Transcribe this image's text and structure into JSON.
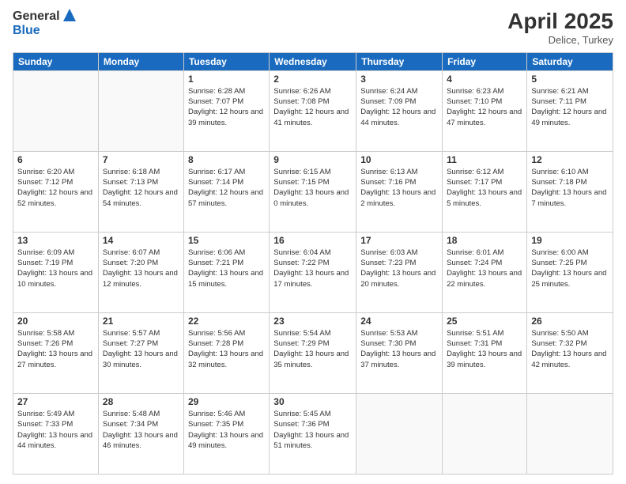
{
  "header": {
    "logo": {
      "general": "General",
      "blue": "Blue"
    },
    "title": "April 2025",
    "location": "Delice, Turkey"
  },
  "calendar": {
    "days_of_week": [
      "Sunday",
      "Monday",
      "Tuesday",
      "Wednesday",
      "Thursday",
      "Friday",
      "Saturday"
    ],
    "weeks": [
      [
        {
          "day": "",
          "info": ""
        },
        {
          "day": "",
          "info": ""
        },
        {
          "day": "1",
          "sunrise": "6:28 AM",
          "sunset": "7:07 PM",
          "daylight": "12 hours and 39 minutes."
        },
        {
          "day": "2",
          "sunrise": "6:26 AM",
          "sunset": "7:08 PM",
          "daylight": "12 hours and 41 minutes."
        },
        {
          "day": "3",
          "sunrise": "6:24 AM",
          "sunset": "7:09 PM",
          "daylight": "12 hours and 44 minutes."
        },
        {
          "day": "4",
          "sunrise": "6:23 AM",
          "sunset": "7:10 PM",
          "daylight": "12 hours and 47 minutes."
        },
        {
          "day": "5",
          "sunrise": "6:21 AM",
          "sunset": "7:11 PM",
          "daylight": "12 hours and 49 minutes."
        }
      ],
      [
        {
          "day": "6",
          "sunrise": "6:20 AM",
          "sunset": "7:12 PM",
          "daylight": "12 hours and 52 minutes."
        },
        {
          "day": "7",
          "sunrise": "6:18 AM",
          "sunset": "7:13 PM",
          "daylight": "12 hours and 54 minutes."
        },
        {
          "day": "8",
          "sunrise": "6:17 AM",
          "sunset": "7:14 PM",
          "daylight": "12 hours and 57 minutes."
        },
        {
          "day": "9",
          "sunrise": "6:15 AM",
          "sunset": "7:15 PM",
          "daylight": "13 hours and 0 minutes."
        },
        {
          "day": "10",
          "sunrise": "6:13 AM",
          "sunset": "7:16 PM",
          "daylight": "13 hours and 2 minutes."
        },
        {
          "day": "11",
          "sunrise": "6:12 AM",
          "sunset": "7:17 PM",
          "daylight": "13 hours and 5 minutes."
        },
        {
          "day": "12",
          "sunrise": "6:10 AM",
          "sunset": "7:18 PM",
          "daylight": "13 hours and 7 minutes."
        }
      ],
      [
        {
          "day": "13",
          "sunrise": "6:09 AM",
          "sunset": "7:19 PM",
          "daylight": "13 hours and 10 minutes."
        },
        {
          "day": "14",
          "sunrise": "6:07 AM",
          "sunset": "7:20 PM",
          "daylight": "13 hours and 12 minutes."
        },
        {
          "day": "15",
          "sunrise": "6:06 AM",
          "sunset": "7:21 PM",
          "daylight": "13 hours and 15 minutes."
        },
        {
          "day": "16",
          "sunrise": "6:04 AM",
          "sunset": "7:22 PM",
          "daylight": "13 hours and 17 minutes."
        },
        {
          "day": "17",
          "sunrise": "6:03 AM",
          "sunset": "7:23 PM",
          "daylight": "13 hours and 20 minutes."
        },
        {
          "day": "18",
          "sunrise": "6:01 AM",
          "sunset": "7:24 PM",
          "daylight": "13 hours and 22 minutes."
        },
        {
          "day": "19",
          "sunrise": "6:00 AM",
          "sunset": "7:25 PM",
          "daylight": "13 hours and 25 minutes."
        }
      ],
      [
        {
          "day": "20",
          "sunrise": "5:58 AM",
          "sunset": "7:26 PM",
          "daylight": "13 hours and 27 minutes."
        },
        {
          "day": "21",
          "sunrise": "5:57 AM",
          "sunset": "7:27 PM",
          "daylight": "13 hours and 30 minutes."
        },
        {
          "day": "22",
          "sunrise": "5:56 AM",
          "sunset": "7:28 PM",
          "daylight": "13 hours and 32 minutes."
        },
        {
          "day": "23",
          "sunrise": "5:54 AM",
          "sunset": "7:29 PM",
          "daylight": "13 hours and 35 minutes."
        },
        {
          "day": "24",
          "sunrise": "5:53 AM",
          "sunset": "7:30 PM",
          "daylight": "13 hours and 37 minutes."
        },
        {
          "day": "25",
          "sunrise": "5:51 AM",
          "sunset": "7:31 PM",
          "daylight": "13 hours and 39 minutes."
        },
        {
          "day": "26",
          "sunrise": "5:50 AM",
          "sunset": "7:32 PM",
          "daylight": "13 hours and 42 minutes."
        }
      ],
      [
        {
          "day": "27",
          "sunrise": "5:49 AM",
          "sunset": "7:33 PM",
          "daylight": "13 hours and 44 minutes."
        },
        {
          "day": "28",
          "sunrise": "5:48 AM",
          "sunset": "7:34 PM",
          "daylight": "13 hours and 46 minutes."
        },
        {
          "day": "29",
          "sunrise": "5:46 AM",
          "sunset": "7:35 PM",
          "daylight": "13 hours and 49 minutes."
        },
        {
          "day": "30",
          "sunrise": "5:45 AM",
          "sunset": "7:36 PM",
          "daylight": "13 hours and 51 minutes."
        },
        {
          "day": "",
          "info": ""
        },
        {
          "day": "",
          "info": ""
        },
        {
          "day": "",
          "info": ""
        }
      ]
    ]
  }
}
